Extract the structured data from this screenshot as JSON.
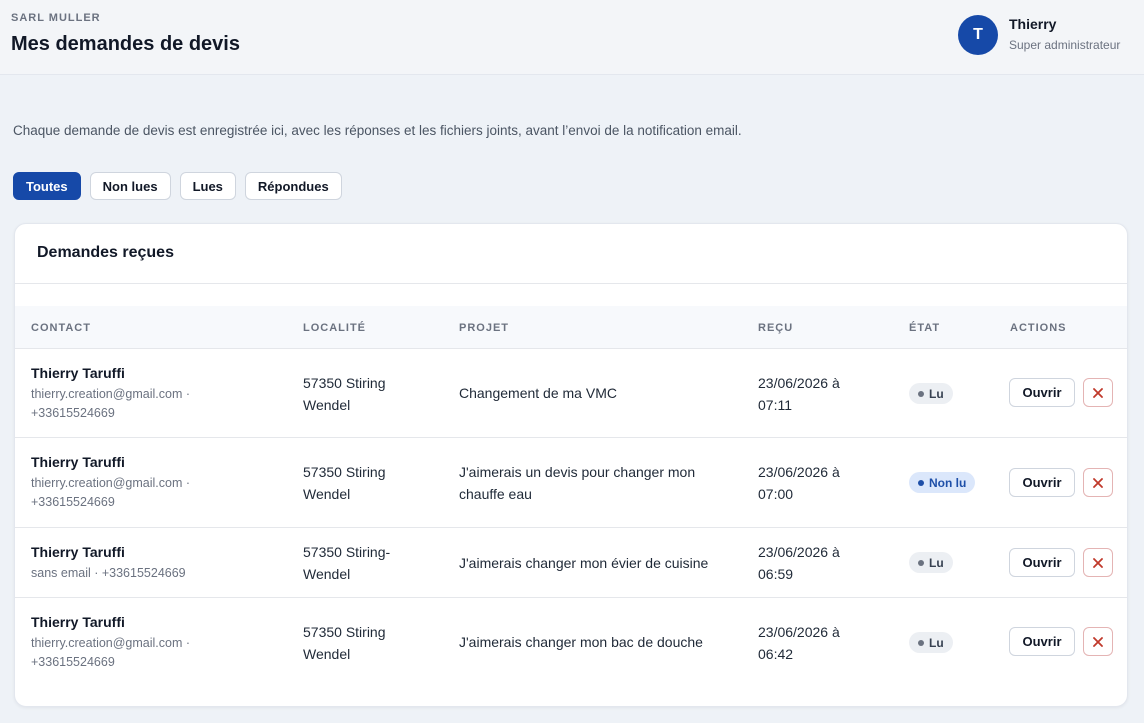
{
  "header": {
    "company": "SARL MULLER",
    "title": "Mes demandes de devis",
    "user": {
      "initial": "T",
      "name": "Thierry",
      "role": "Super administrateur"
    }
  },
  "intro": "Chaque demande de devis est enregistrée ici, avec les réponses et les fichiers joints, avant l’envoi de la notification email.",
  "filters": [
    {
      "label": "Toutes",
      "active": true
    },
    {
      "label": "Non lues",
      "active": false
    },
    {
      "label": "Lues",
      "active": false
    },
    {
      "label": "Répondues",
      "active": false
    }
  ],
  "table": {
    "title": "Demandes reçues",
    "columns": [
      "CONTACT",
      "LOCALITÉ",
      "PROJET",
      "REÇU",
      "ÉTAT",
      "ACTIONS"
    ],
    "open_label": "Ouvrir",
    "rows": [
      {
        "name": "Thierry Taruffi",
        "contact_line1": "thierry.creation@gmail.com ·",
        "contact_line2": "+33615524669",
        "locality_line1": "57350 Stiring",
        "locality_line2": "Wendel",
        "project_line1": "Changement de ma VMC",
        "project_line2": "",
        "date_line1": "23/06/2026 à",
        "date_line2": "07:11",
        "status": "Lu",
        "status_type": "read"
      },
      {
        "name": "Thierry Taruffi",
        "contact_line1": "thierry.creation@gmail.com ·",
        "contact_line2": "+33615524669",
        "locality_line1": "57350 Stiring",
        "locality_line2": "Wendel",
        "project_line1": "J'aimerais un devis pour changer mon",
        "project_line2": "chauffe eau",
        "date_line1": "23/06/2026 à",
        "date_line2": "07:00",
        "status": "Non lu",
        "status_type": "unread"
      },
      {
        "name": "Thierry Taruffi",
        "contact_line1": "sans email · +33615524669",
        "contact_line2": "",
        "locality_line1": "57350 Stiring-",
        "locality_line2": "Wendel",
        "project_line1": "J'aimerais changer mon évier de cuisine",
        "project_line2": "",
        "date_line1": "23/06/2026 à",
        "date_line2": "06:59",
        "status": "Lu",
        "status_type": "read"
      },
      {
        "name": "Thierry Taruffi",
        "contact_line1": "thierry.creation@gmail.com ·",
        "contact_line2": "+33615524669",
        "locality_line1": "57350 Stiring",
        "locality_line2": "Wendel",
        "project_line1": "J'aimerais changer mon bac de douche",
        "project_line2": "",
        "date_line1": "23/06/2026 à",
        "date_line2": "06:42",
        "status": "Lu",
        "status_type": "read"
      }
    ]
  },
  "colors": {
    "accent": "#1649a8",
    "delete_icon": "#c0392b"
  },
  "icons": {
    "delete": "close-icon"
  }
}
